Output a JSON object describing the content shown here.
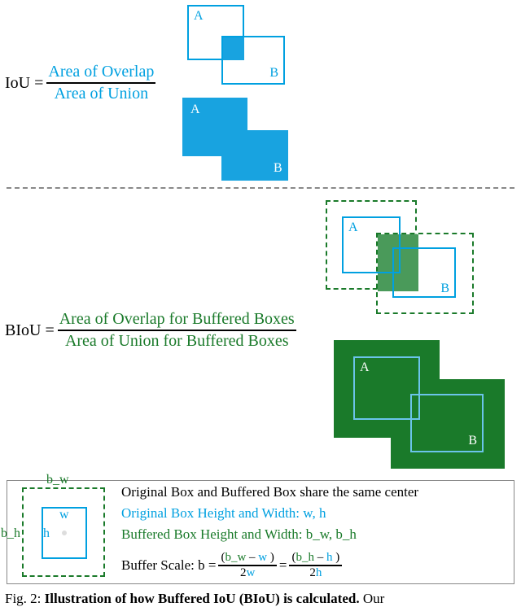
{
  "iou": {
    "lhs": "IoU =",
    "numerator": "Area of Overlap",
    "denominator": "Area of Union",
    "boxA": "A",
    "boxB": "B"
  },
  "biou": {
    "lhs": "BIoU =",
    "numerator": "Area of Overlap for Buffered Boxes",
    "denominator": "Area of Union for Buffered Boxes",
    "boxA": "A",
    "boxB": "B"
  },
  "legend": {
    "bw": "b_w",
    "bh": "b_h",
    "w": "w",
    "h": "h",
    "line1": "Original Box and Buffered Box share the same center",
    "line2_pre": "Original Box Height and Width: ",
    "line2_vals": "w, h",
    "line3_pre": "Buffered Box Height and Width: ",
    "line3_vals": "b_w, b_h",
    "line4_pre": "Buffer Scale: b = ",
    "frac1_num_part1": "(",
    "frac1_num_bw": "b_w",
    "frac1_num_minus": " – ",
    "frac1_num_w": "w",
    "frac1_num_part2": " )",
    "frac1_den": "2",
    "frac1_den_w": "w",
    "eq": " = ",
    "frac2_num_part1": "(",
    "frac2_num_bh": "b_h",
    "frac2_num_minus": " – ",
    "frac2_num_h": "h",
    "frac2_num_part2": " )",
    "frac2_den": "2",
    "frac2_den_h": "h"
  },
  "caption": {
    "fig_label": "Fig. 2: ",
    "bold": "Illustration of how Buffered IoU (BIoU) is calculated.",
    "rest": " Our"
  },
  "colors": {
    "blue": "#00a0e0",
    "green": "#1a7a2a"
  }
}
